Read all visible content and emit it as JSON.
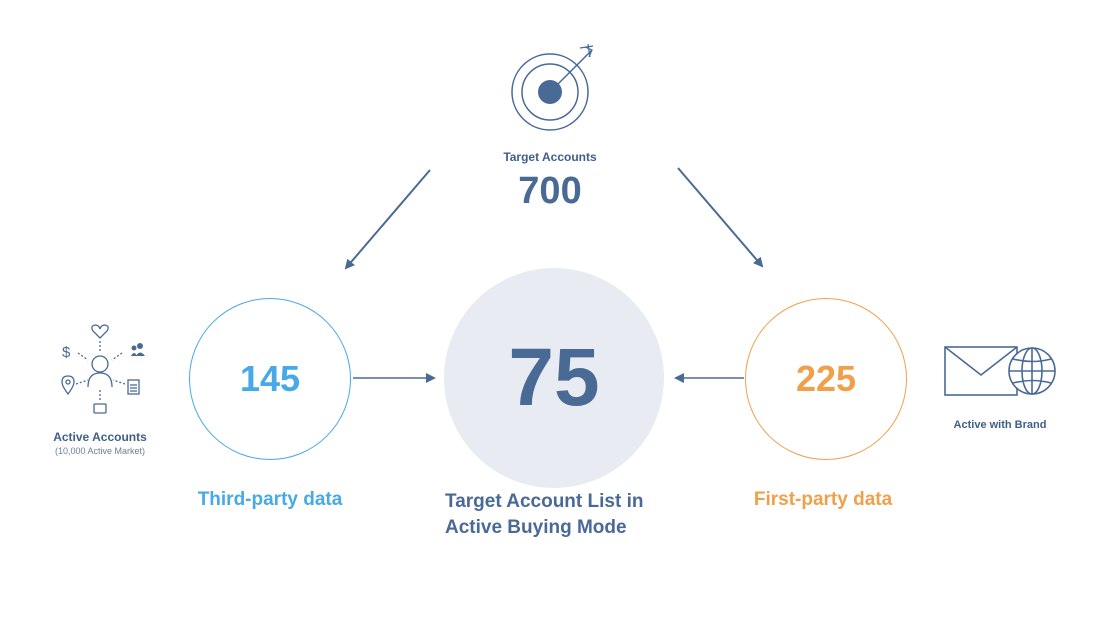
{
  "top": {
    "label": "Target Accounts",
    "value": "700"
  },
  "left": {
    "value": "145",
    "caption": "Third-party data",
    "source_label": "Active Accounts",
    "source_sublabel": "(10,000 Active Market)"
  },
  "center": {
    "value": "75",
    "caption_line1": "Target Account List in",
    "caption_line2": "Active Buying Mode"
  },
  "right": {
    "value": "225",
    "caption": "First-party data",
    "source_label": "Active with Brand"
  },
  "icons": {
    "top": "target-icon",
    "left": "person-network-icon",
    "right": "envelope-globe-icon"
  },
  "colors": {
    "navy": "#4a6a96",
    "blue": "#47a9e6",
    "orange": "#f0a04b",
    "center_fill": "#e8ecf2"
  }
}
